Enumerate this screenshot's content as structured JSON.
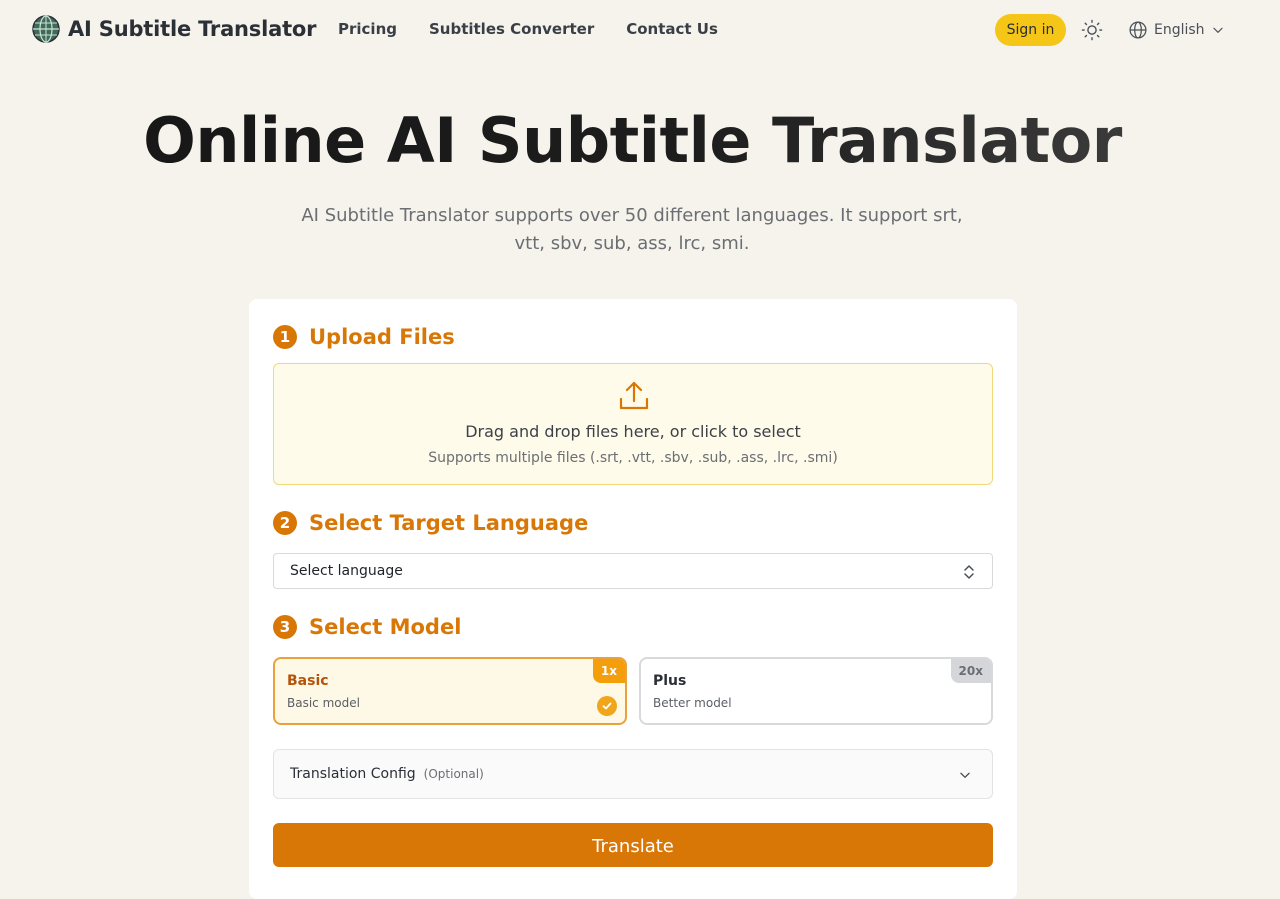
{
  "header": {
    "brand_title": "AI Subtitle Translator",
    "nav": [
      "Pricing",
      "Subtitles Converter",
      "Contact Us"
    ],
    "sign_in": "Sign in",
    "language": "English"
  },
  "hero": {
    "title": "Online AI Subtitle Translator",
    "subtitle": "AI Subtitle Translator supports over 50 different languages. It support srt, vtt, sbv, sub, ass, lrc, smi."
  },
  "steps": {
    "upload": {
      "number": "1",
      "label": "Upload Files",
      "dropzone_main": "Drag and drop files here, or click to select",
      "dropzone_sub": "Supports multiple files (.srt, .vtt, .sbv, .sub, .ass, .lrc, .smi)"
    },
    "language": {
      "number": "2",
      "label": "Select Target Language",
      "select_value": "Select language"
    },
    "model": {
      "number": "3",
      "label": "Select Model",
      "options": [
        {
          "name": "Basic",
          "desc": "Basic model",
          "badge": "1x",
          "selected": true
        },
        {
          "name": "Plus",
          "desc": "Better model",
          "badge": "20x",
          "selected": false
        }
      ]
    }
  },
  "config": {
    "label": "Translation Config",
    "optional": "(Optional)"
  },
  "translate_button": "Translate",
  "colors": {
    "accent": "#d97706",
    "signin": "#f5c518",
    "background": "#f5f3ec"
  }
}
